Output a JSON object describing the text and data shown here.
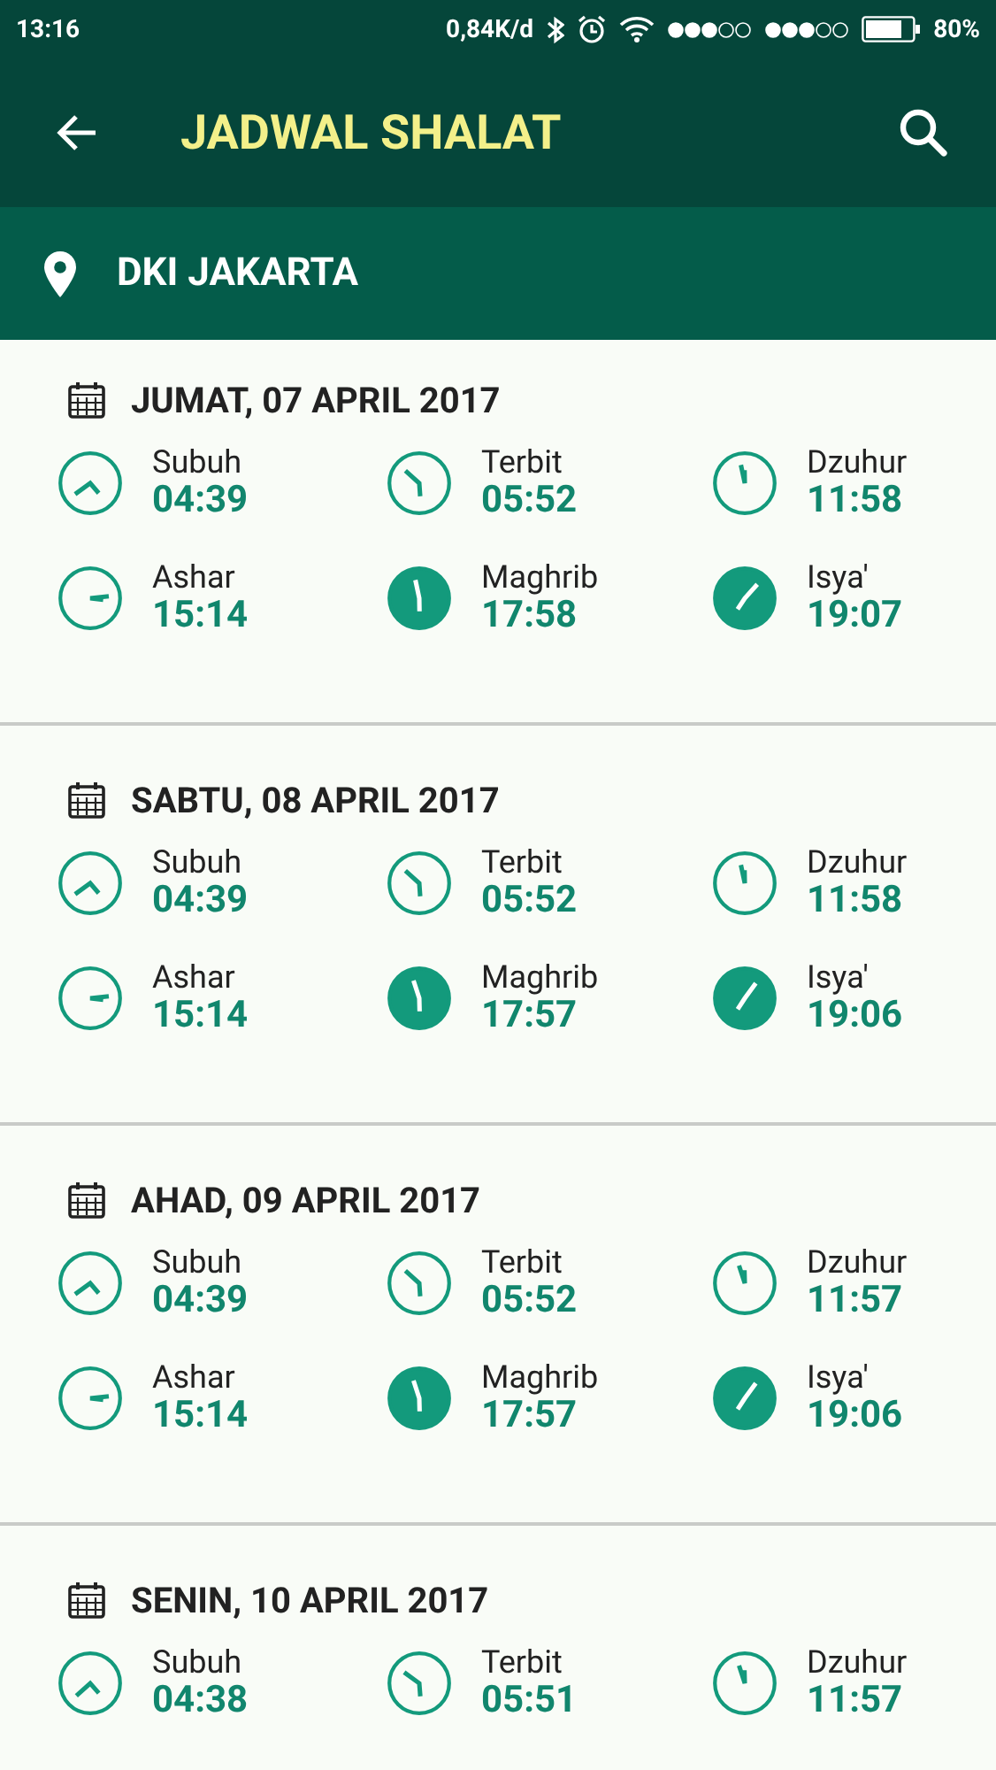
{
  "status_bar": {
    "time": "13:16",
    "speed": "0,84K/d",
    "battery": "80%"
  },
  "app_bar": {
    "title": "JADWAL SHALAT"
  },
  "location": {
    "name": "DKI JAKARTA"
  },
  "days": [
    {
      "date": "JUMAT, 07 APRIL 2017",
      "prayers": [
        {
          "name": "Subuh",
          "time": "04:39",
          "kind": "day"
        },
        {
          "name": "Terbit",
          "time": "05:52",
          "kind": "day"
        },
        {
          "name": "Dzuhur",
          "time": "11:58",
          "kind": "day"
        },
        {
          "name": "Ashar",
          "time": "15:14",
          "kind": "day"
        },
        {
          "name": "Maghrib",
          "time": "17:58",
          "kind": "night"
        },
        {
          "name": "Isya'",
          "time": "19:07",
          "kind": "night"
        }
      ]
    },
    {
      "date": "SABTU, 08 APRIL 2017",
      "prayers": [
        {
          "name": "Subuh",
          "time": "04:39",
          "kind": "day"
        },
        {
          "name": "Terbit",
          "time": "05:52",
          "kind": "day"
        },
        {
          "name": "Dzuhur",
          "time": "11:58",
          "kind": "day"
        },
        {
          "name": "Ashar",
          "time": "15:14",
          "kind": "day"
        },
        {
          "name": "Maghrib",
          "time": "17:57",
          "kind": "night"
        },
        {
          "name": "Isya'",
          "time": "19:06",
          "kind": "night"
        }
      ]
    },
    {
      "date": "AHAD, 09 APRIL 2017",
      "prayers": [
        {
          "name": "Subuh",
          "time": "04:39",
          "kind": "day"
        },
        {
          "name": "Terbit",
          "time": "05:52",
          "kind": "day"
        },
        {
          "name": "Dzuhur",
          "time": "11:57",
          "kind": "day"
        },
        {
          "name": "Ashar",
          "time": "15:14",
          "kind": "day"
        },
        {
          "name": "Maghrib",
          "time": "17:57",
          "kind": "night"
        },
        {
          "name": "Isya'",
          "time": "19:06",
          "kind": "night"
        }
      ]
    },
    {
      "date": "SENIN, 10 APRIL 2017",
      "prayers": [
        {
          "name": "Subuh",
          "time": "04:38",
          "kind": "day"
        },
        {
          "name": "Terbit",
          "time": "05:51",
          "kind": "day"
        },
        {
          "name": "Dzuhur",
          "time": "11:57",
          "kind": "day"
        }
      ]
    }
  ]
}
